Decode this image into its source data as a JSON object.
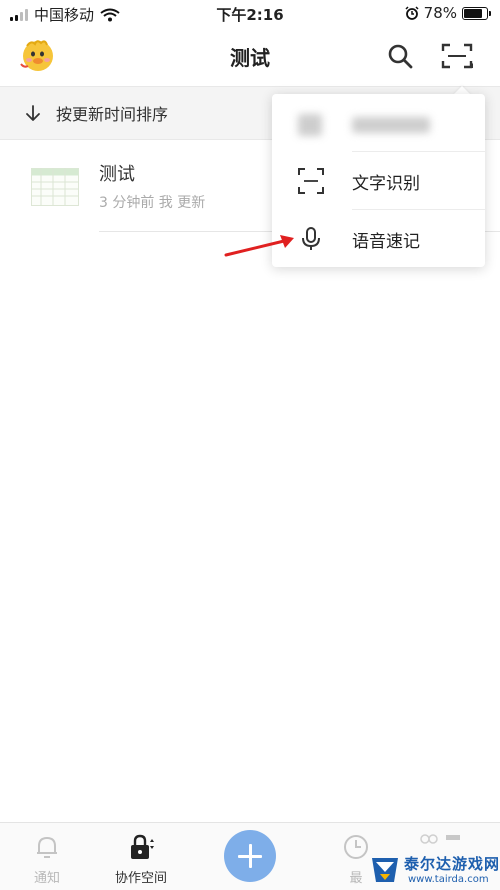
{
  "status_bar": {
    "carrier": "中国移动",
    "time": "下午2:16",
    "battery": "78%",
    "battery_level": 0.78
  },
  "header": {
    "title": "测试"
  },
  "sort_bar": {
    "label": "按更新时间排序"
  },
  "files": [
    {
      "name": "测试",
      "meta": "3 分钟前 我 更新"
    }
  ],
  "menu": {
    "items": [
      {
        "label": "",
        "icon": "blurred-icon",
        "blurred": true
      },
      {
        "label": "文字识别",
        "icon": "scan-frame-icon"
      },
      {
        "label": "语音速记",
        "icon": "microphone-icon"
      }
    ]
  },
  "tab_bar": {
    "notice_label": "通知",
    "space_label": "协作空间",
    "recent_label": "最"
  },
  "watermark": {
    "text": "泰尔达游戏网",
    "url": "www.tairda.com"
  },
  "colors": {
    "accent": "#7eaee9",
    "annotation_arrow": "#e02020",
    "watermark_blue": "#1e5fae"
  }
}
